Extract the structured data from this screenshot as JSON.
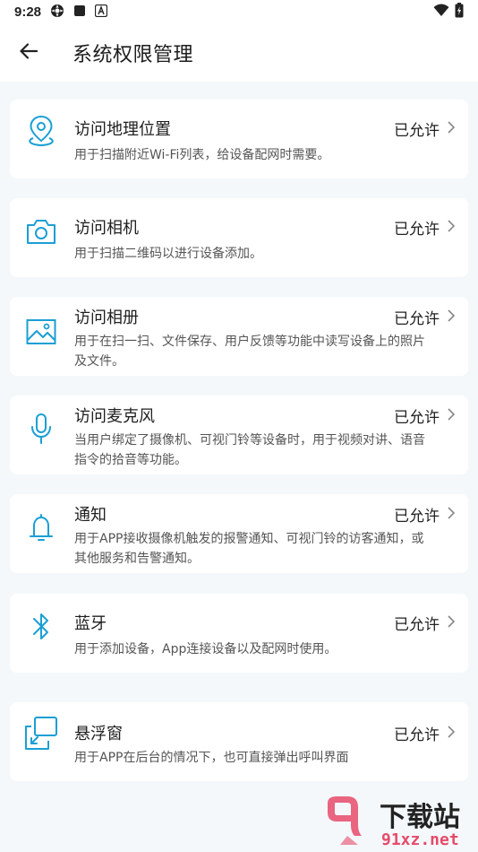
{
  "status_bar": {
    "time": "9:28",
    "icons_left": [
      "settings-icon",
      "notification-icon",
      "app-icon"
    ],
    "icons_right": [
      "wifi-icon",
      "battery-icon"
    ]
  },
  "header": {
    "title": "系统权限管理",
    "back_icon": "arrow-left-icon"
  },
  "colors": {
    "accent": "#1a9fd4",
    "background": "#f4f8fb",
    "card": "#ffffff"
  },
  "permissions": [
    {
      "title": "访问地理位置",
      "status": "已允许",
      "desc_lines": [
        "用于扫描附近Wi-Fi列表，给设备配网时需要。"
      ],
      "icon": "location-pin-icon"
    },
    {
      "title": "访问相机",
      "status": "已允许",
      "desc_lines": [
        "用于扫描二维码以进行设备添加。"
      ],
      "icon": "camera-icon"
    },
    {
      "title": "访问相册",
      "status": "已允许",
      "desc_lines": [
        "用于在扫一扫、文件保存、用户反馈等功能中读写设备上的照片",
        "及文件。"
      ],
      "icon": "image-icon"
    },
    {
      "title": "访问麦克风",
      "status": "已允许",
      "desc_lines": [
        "当用户绑定了摄像机、可视门铃等设备时，用于视频对讲、语音",
        "指令的拾音等功能。"
      ],
      "icon": "microphone-icon"
    },
    {
      "title": "通知",
      "status": "已允许",
      "desc_lines": [
        "用于APP接收摄像机触发的报警通知、可视门铃的访客通知，或",
        "其他服务和告警通知。"
      ],
      "icon": "bell-icon"
    },
    {
      "title": "蓝牙",
      "status": "已允许",
      "desc_lines": [
        "用于添加设备，App连接设备以及配网时使用。"
      ],
      "icon": "bluetooth-icon"
    },
    {
      "title": "悬浮窗",
      "status": "已允许",
      "desc_lines": [
        "用于APP在后台的情况下，也可直接弹出呼叫界面"
      ],
      "icon": "floating-window-icon"
    }
  ],
  "watermark": {
    "brand_text": "下载站",
    "site_text": "91xz.net"
  }
}
